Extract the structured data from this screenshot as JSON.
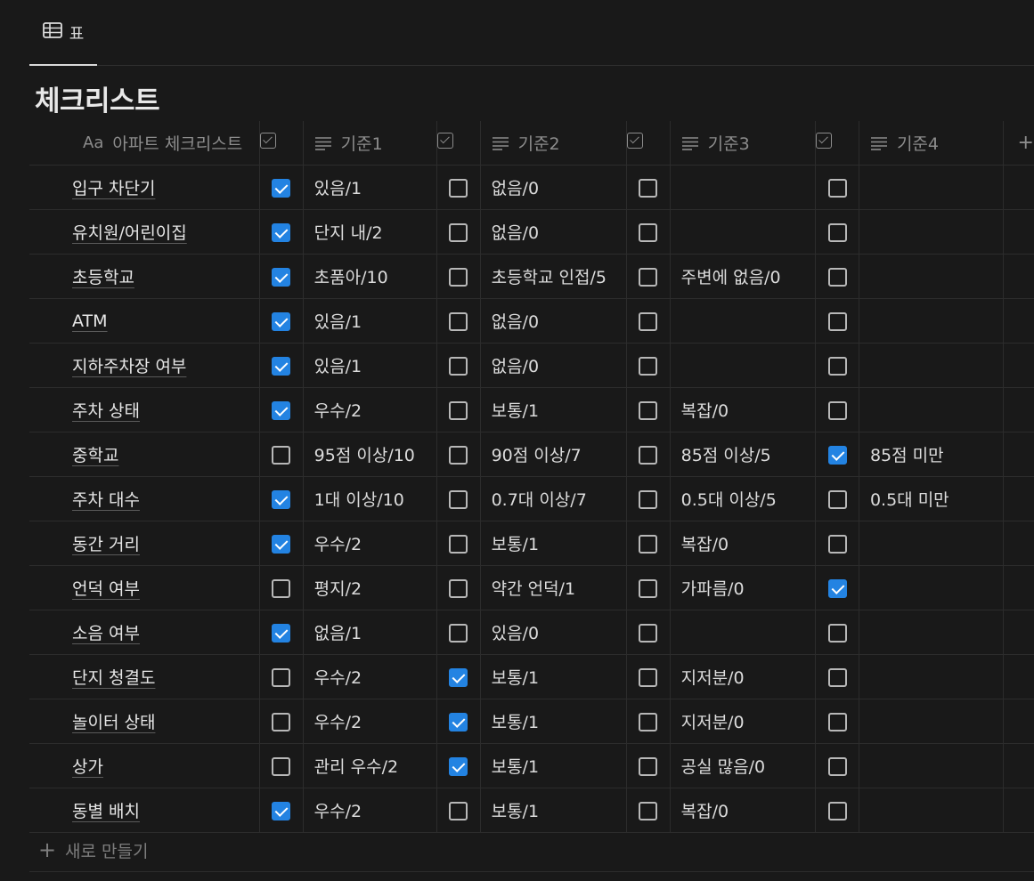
{
  "tab": {
    "icon": "table-icon",
    "label": "표"
  },
  "title": "체크리스트",
  "headers": {
    "name": "아파트 체크리스트",
    "name_icon": "Aa",
    "c1": "기준1",
    "c2": "기준2",
    "c3": "기준3",
    "c4": "기준4",
    "add": "+"
  },
  "rows": [
    {
      "name": "입구 차단기",
      "checks": [
        true,
        false,
        false,
        false
      ],
      "c": [
        "있음/1",
        "없음/0",
        "",
        ""
      ]
    },
    {
      "name": "유치원/어린이집",
      "checks": [
        true,
        false,
        false,
        false
      ],
      "c": [
        "단지 내/2",
        "없음/0",
        "",
        ""
      ]
    },
    {
      "name": "초등학교",
      "checks": [
        true,
        false,
        false,
        false
      ],
      "c": [
        "초품아/10",
        "초등학교 인접/5",
        "주변에 없음/0",
        ""
      ]
    },
    {
      "name": "ATM",
      "checks": [
        true,
        false,
        false,
        false
      ],
      "c": [
        "있음/1",
        "없음/0",
        "",
        ""
      ]
    },
    {
      "name": "지하주차장 여부",
      "checks": [
        true,
        false,
        false,
        false
      ],
      "c": [
        "있음/1",
        "없음/0",
        "",
        ""
      ]
    },
    {
      "name": "주차 상태",
      "checks": [
        true,
        false,
        false,
        false
      ],
      "c": [
        "우수/2",
        "보통/1",
        "복잡/0",
        ""
      ]
    },
    {
      "name": "중학교",
      "checks": [
        false,
        false,
        false,
        true
      ],
      "c": [
        "95점 이상/10",
        "90점 이상/7",
        "85점 이상/5",
        "85점 미만"
      ]
    },
    {
      "name": "주차 대수",
      "checks": [
        true,
        false,
        false,
        false
      ],
      "c": [
        "1대 이상/10",
        "0.7대 이상/7",
        "0.5대 이상/5",
        "0.5대 미만"
      ]
    },
    {
      "name": "동간 거리",
      "checks": [
        true,
        false,
        false,
        false
      ],
      "c": [
        "우수/2",
        "보통/1",
        "복잡/0",
        ""
      ]
    },
    {
      "name": "언덕 여부",
      "checks": [
        false,
        false,
        false,
        true
      ],
      "c": [
        "평지/2",
        "약간 언덕/1",
        "가파름/0",
        ""
      ]
    },
    {
      "name": "소음 여부",
      "checks": [
        true,
        false,
        false,
        false
      ],
      "c": [
        "없음/1",
        "있음/0",
        "",
        ""
      ]
    },
    {
      "name": "단지 청결도",
      "checks": [
        false,
        true,
        false,
        false
      ],
      "c": [
        "우수/2",
        "보통/1",
        "지저분/0",
        ""
      ]
    },
    {
      "name": "놀이터 상태",
      "checks": [
        false,
        true,
        false,
        false
      ],
      "c": [
        "우수/2",
        "보통/1",
        "지저분/0",
        ""
      ]
    },
    {
      "name": "상가",
      "checks": [
        false,
        true,
        false,
        false
      ],
      "c": [
        "관리 우수/2",
        "보통/1",
        "공실 많음/0",
        ""
      ]
    },
    {
      "name": "동별 배치",
      "checks": [
        true,
        false,
        false,
        false
      ],
      "c": [
        "우수/2",
        "보통/1",
        "복잡/0",
        ""
      ]
    }
  ],
  "new_row_label": "새로 만들기",
  "colors": {
    "background": "#191919",
    "checkbox_checked": "#2383e2",
    "text": "#d4d4d4",
    "muted": "#8c8c8c"
  }
}
